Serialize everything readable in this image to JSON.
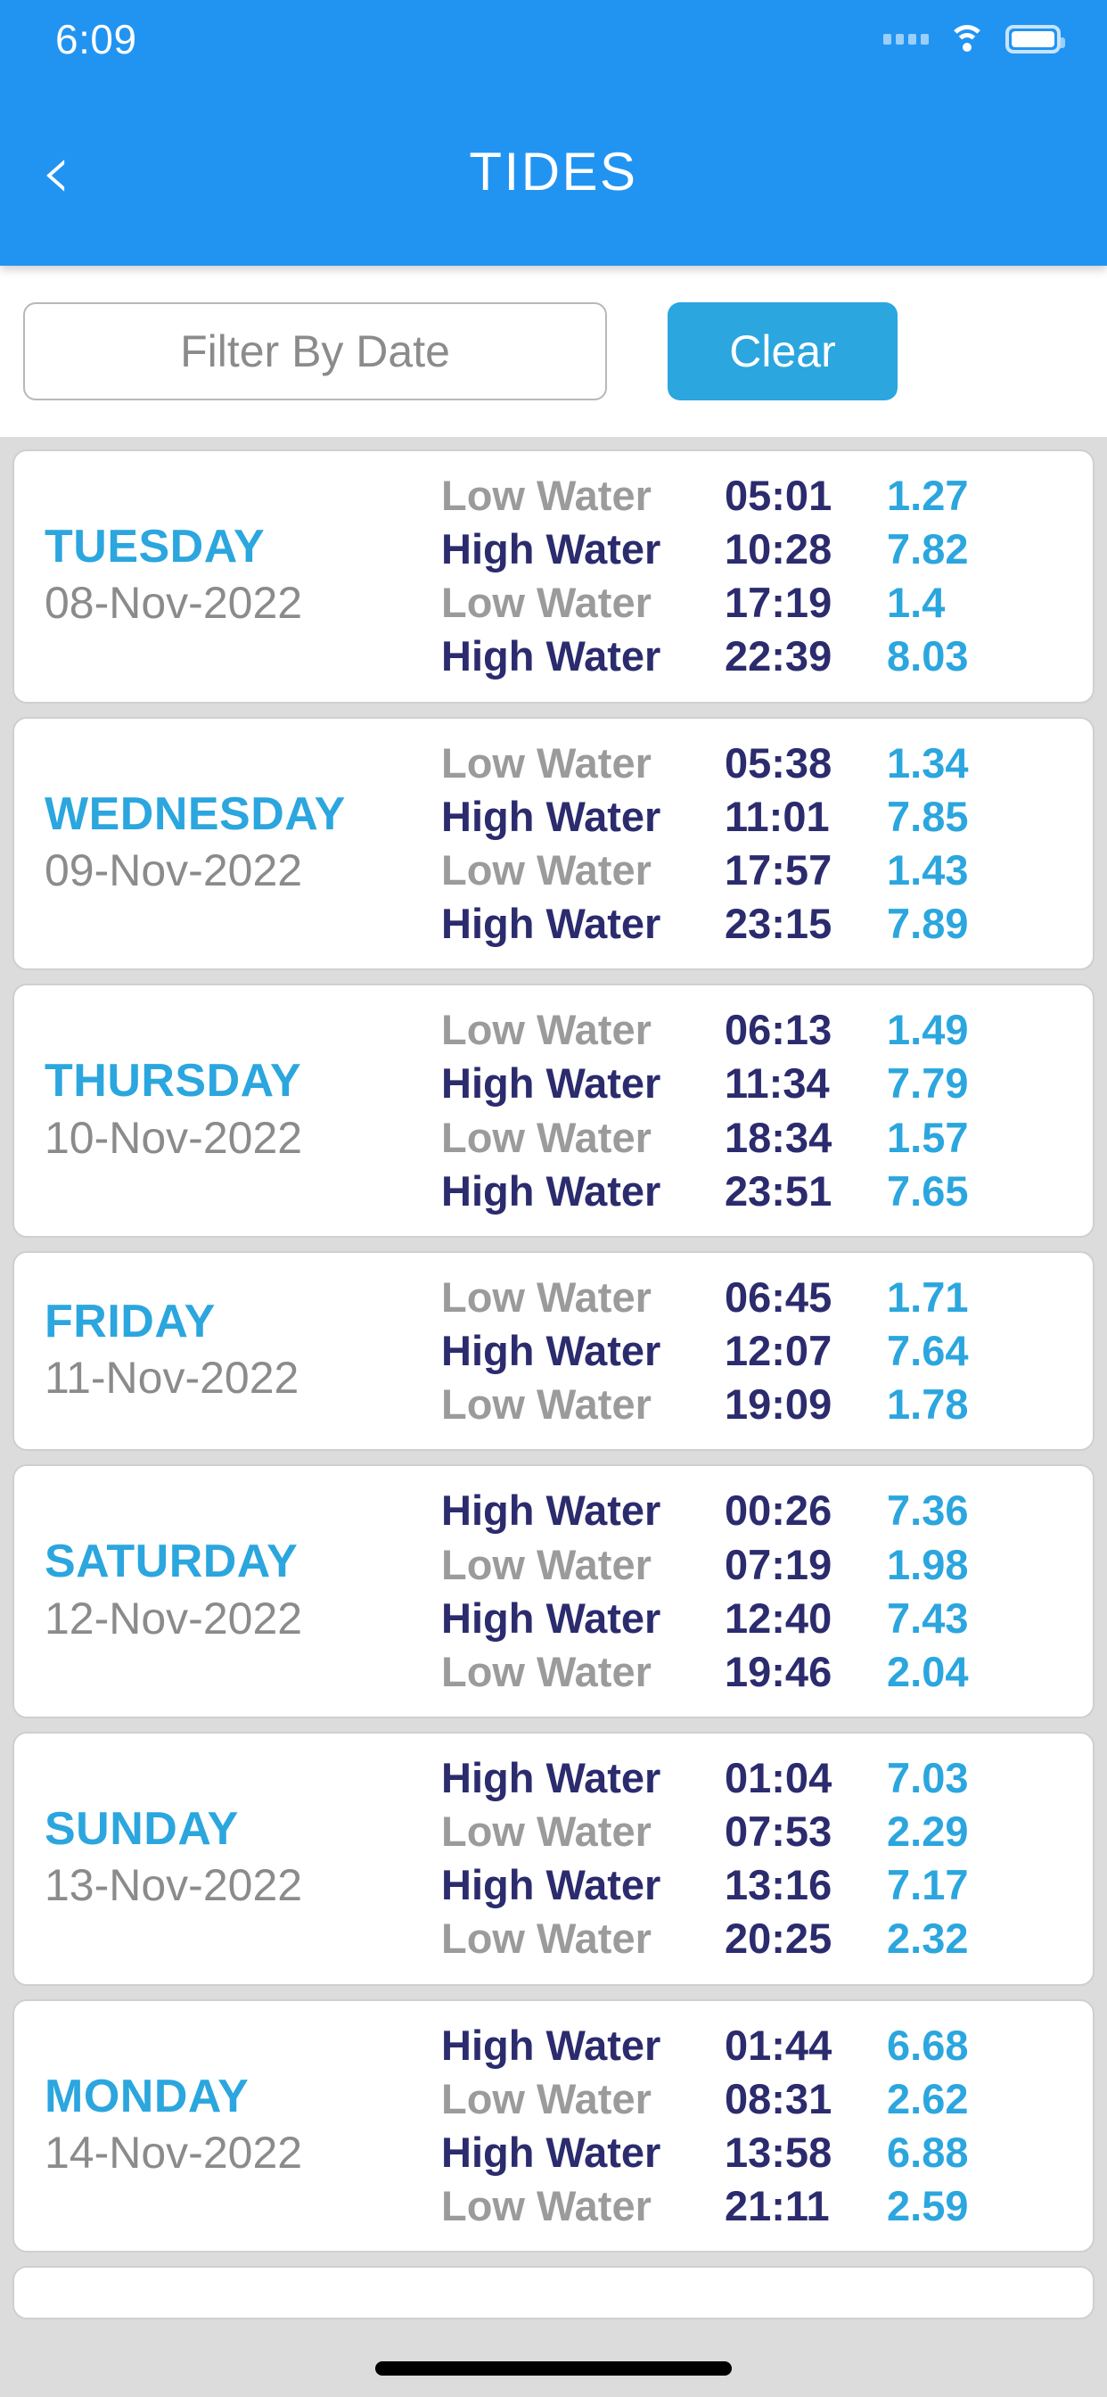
{
  "status_bar": {
    "time": "6:09",
    "signal_icon": "signal-dots-icon",
    "wifi_icon": "wifi-icon",
    "battery_icon": "battery-icon"
  },
  "header": {
    "back_icon": "chevron-left-icon",
    "title": "TIDES",
    "background_color": "#2194f2"
  },
  "filter": {
    "placeholder": "Filter By Date",
    "value": "",
    "clear_label": "Clear",
    "clear_color": "#2ba6de"
  },
  "colors": {
    "accent": "#2ba6de",
    "high_water": "#2b2b6e",
    "low_water": "#9b9b9b",
    "date_text": "#8b8b8b",
    "card_bg": "#ffffff",
    "list_bg": "#dcdcdc"
  },
  "days": [
    {
      "name": "TUESDAY",
      "date": "08-Nov-2022",
      "tides": [
        {
          "type": "Low Water",
          "time": "05:01",
          "height": "1.27"
        },
        {
          "type": "High Water",
          "time": "10:28",
          "height": "7.82"
        },
        {
          "type": "Low Water",
          "time": "17:19",
          "height": "1.4"
        },
        {
          "type": "High Water",
          "time": "22:39",
          "height": "8.03"
        }
      ]
    },
    {
      "name": "WEDNESDAY",
      "date": "09-Nov-2022",
      "tides": [
        {
          "type": "Low Water",
          "time": "05:38",
          "height": "1.34"
        },
        {
          "type": "High Water",
          "time": "11:01",
          "height": "7.85"
        },
        {
          "type": "Low Water",
          "time": "17:57",
          "height": "1.43"
        },
        {
          "type": "High Water",
          "time": "23:15",
          "height": "7.89"
        }
      ]
    },
    {
      "name": "THURSDAY",
      "date": "10-Nov-2022",
      "tides": [
        {
          "type": "Low Water",
          "time": "06:13",
          "height": "1.49"
        },
        {
          "type": "High Water",
          "time": "11:34",
          "height": "7.79"
        },
        {
          "type": "Low Water",
          "time": "18:34",
          "height": "1.57"
        },
        {
          "type": "High Water",
          "time": "23:51",
          "height": "7.65"
        }
      ]
    },
    {
      "name": "FRIDAY",
      "date": "11-Nov-2022",
      "tides": [
        {
          "type": "Low Water",
          "time": "06:45",
          "height": "1.71"
        },
        {
          "type": "High Water",
          "time": "12:07",
          "height": "7.64"
        },
        {
          "type": "Low Water",
          "time": "19:09",
          "height": "1.78"
        }
      ]
    },
    {
      "name": "SATURDAY",
      "date": "12-Nov-2022",
      "tides": [
        {
          "type": "High Water",
          "time": "00:26",
          "height": "7.36"
        },
        {
          "type": "Low Water",
          "time": "07:19",
          "height": "1.98"
        },
        {
          "type": "High Water",
          "time": "12:40",
          "height": "7.43"
        },
        {
          "type": "Low Water",
          "time": "19:46",
          "height": "2.04"
        }
      ]
    },
    {
      "name": "SUNDAY",
      "date": "13-Nov-2022",
      "tides": [
        {
          "type": "High Water",
          "time": "01:04",
          "height": "7.03"
        },
        {
          "type": "Low Water",
          "time": "07:53",
          "height": "2.29"
        },
        {
          "type": "High Water",
          "time": "13:16",
          "height": "7.17"
        },
        {
          "type": "Low Water",
          "time": "20:25",
          "height": "2.32"
        }
      ]
    },
    {
      "name": "MONDAY",
      "date": "14-Nov-2022",
      "tides": [
        {
          "type": "High Water",
          "time": "01:44",
          "height": "6.68"
        },
        {
          "type": "Low Water",
          "time": "08:31",
          "height": "2.62"
        },
        {
          "type": "High Water",
          "time": "13:58",
          "height": "6.88"
        },
        {
          "type": "Low Water",
          "time": "21:11",
          "height": "2.59"
        }
      ]
    }
  ]
}
